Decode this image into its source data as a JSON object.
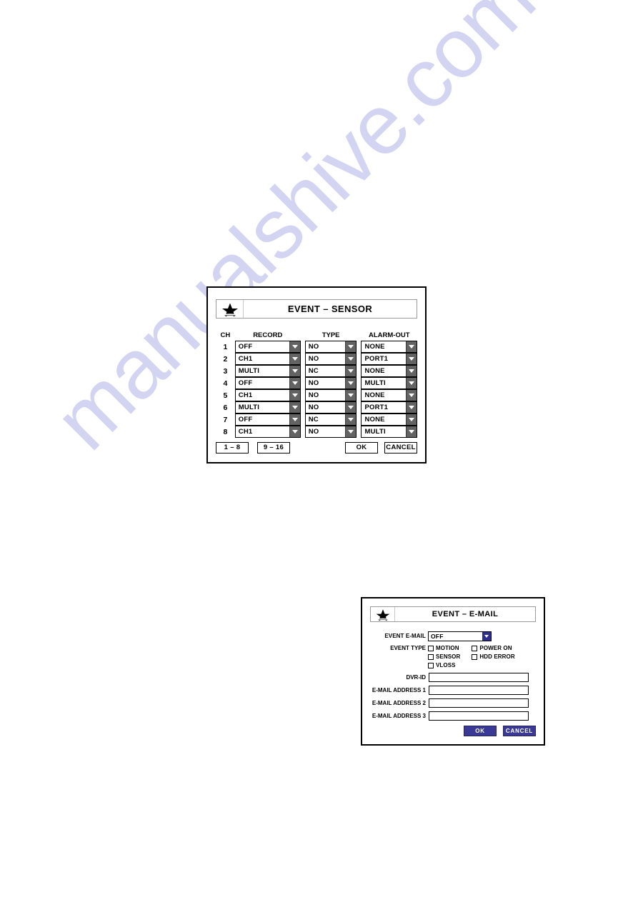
{
  "watermark": {
    "text": "manualshive.com",
    "color": "#d3d4f2"
  },
  "sensor_dialog": {
    "title": "EVENT – SENSOR",
    "star_icon": "star-icon",
    "columns": {
      "ch": "CH",
      "record": "RECORD",
      "type": "TYPE",
      "alarm_out": "ALARM-OUT"
    },
    "rows": [
      {
        "ch": "1",
        "record": "OFF",
        "type": "NO",
        "alarm_out": "NONE"
      },
      {
        "ch": "2",
        "record": "CH1",
        "type": "NO",
        "alarm_out": "PORT1"
      },
      {
        "ch": "3",
        "record": "MULTI",
        "type": "NC",
        "alarm_out": "NONE"
      },
      {
        "ch": "4",
        "record": "OFF",
        "type": "NO",
        "alarm_out": "MULTI"
      },
      {
        "ch": "5",
        "record": "CH1",
        "type": "NO",
        "alarm_out": "NONE"
      },
      {
        "ch": "6",
        "record": "MULTI",
        "type": "NO",
        "alarm_out": "PORT1"
      },
      {
        "ch": "7",
        "record": "OFF",
        "type": "NC",
        "alarm_out": "NONE"
      },
      {
        "ch": "8",
        "record": "CH1",
        "type": "NO",
        "alarm_out": "MULTI"
      }
    ],
    "buttons": {
      "page_1_8": "1 – 8",
      "page_9_16": "9 – 16",
      "ok": "OK",
      "cancel": "CANCEL"
    },
    "dropdown_arrow_color": "#636363"
  },
  "email_dialog": {
    "title": "EVENT – E-MAIL",
    "star_icon": "star-icon",
    "event_email": {
      "label": "EVENT E-MAIL",
      "value": "OFF"
    },
    "event_type": {
      "label": "EVENT TYPE",
      "column_1": [
        {
          "label": "MOTION",
          "checked": false
        },
        {
          "label": "SENSOR",
          "checked": false
        },
        {
          "label": "VLOSS",
          "checked": false
        }
      ],
      "column_2": [
        {
          "label": "POWER ON",
          "checked": false
        },
        {
          "label": "HDD ERROR",
          "checked": false
        }
      ]
    },
    "fields": [
      {
        "label": "DVR-ID",
        "value": ""
      },
      {
        "label": "E-MAIL ADDRESS 1",
        "value": ""
      },
      {
        "label": "E-MAIL ADDRESS 2",
        "value": ""
      },
      {
        "label": "E-MAIL ADDRESS 3",
        "value": ""
      }
    ],
    "buttons": {
      "ok": "OK",
      "cancel": "CANCEL"
    },
    "accent_color": "#3a3a96"
  }
}
